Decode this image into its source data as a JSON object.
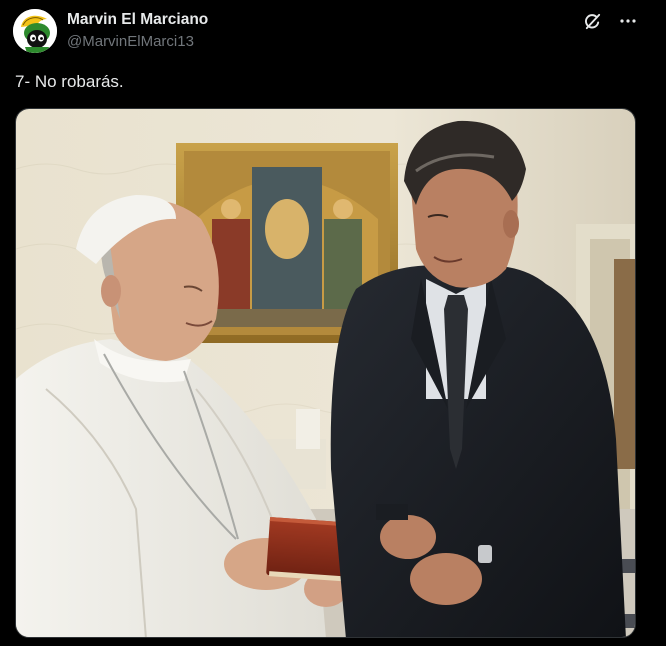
{
  "author": {
    "display_name": "Marvin El Marciano",
    "handle": "@MarvinElMarci13"
  },
  "tweet": {
    "text": "7- No robarás."
  },
  "icons": {
    "avatar": "marvin-the-martian-avatar",
    "grok": "grok-icon",
    "more": "more-options-icon"
  },
  "colors": {
    "background": "#000000",
    "text_primary": "#e7e9ea",
    "text_secondary": "#71767b",
    "border": "#2f3336"
  }
}
